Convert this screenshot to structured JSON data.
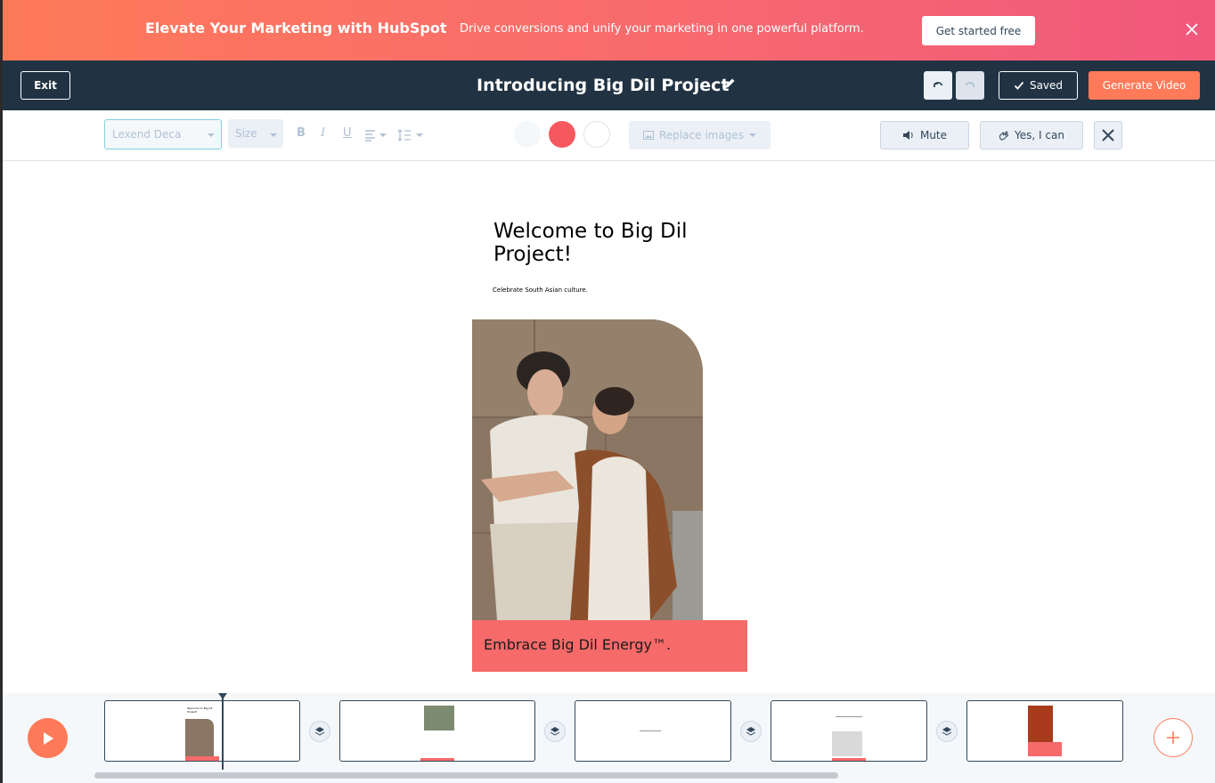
{
  "banner": {
    "title": "Elevate Your Marketing with HubSpot",
    "subtitle": "Drive conversions and unify your marketing in one powerful platform.",
    "cta": "Get started free",
    "colors": {
      "start": "#ff7a59",
      "end": "#f0587c"
    }
  },
  "header": {
    "exit_label": "Exit",
    "title": "Introducing Big Dil Project",
    "saved_label": "Saved",
    "generate_label": "Generate Video"
  },
  "toolbar": {
    "font_value": "Lexend Deca",
    "size_label": "Size",
    "bold": "B",
    "italic": "I",
    "underline": "U",
    "swatches": [
      "#f5f8fa",
      "#f5585e",
      "#ffffff"
    ],
    "replace_images_label": "Replace images",
    "mute_label": "Mute",
    "yes_label": "Yes, I can"
  },
  "slide": {
    "heading": "Welcome to Big Dil Project!",
    "subheading": "Celebrate South Asian culture.",
    "caption": "Embrace Big Dil Energy™.",
    "accent": "#f66a6a"
  },
  "timeline": {
    "thumbnails": [
      {
        "title": "Welcome to Big Dil Project!"
      },
      {
        "title": ""
      },
      {
        "title": ""
      },
      {
        "title": ""
      },
      {
        "title": ""
      }
    ]
  }
}
